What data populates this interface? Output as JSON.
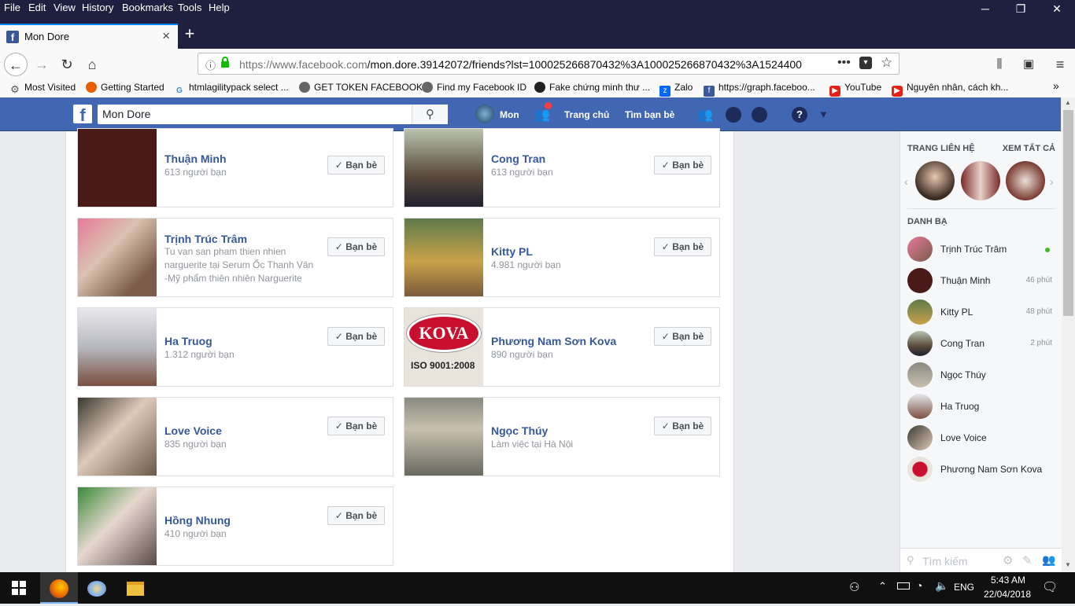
{
  "browser": {
    "menu": [
      "File",
      "Edit",
      "View",
      "History",
      "Bookmarks",
      "Tools",
      "Help"
    ],
    "tab_title": "Mon Dore",
    "url_host": "https://www.facebook.com",
    "url_path": "/mon.dore.39142072/friends?lst=100025266870432%3A100025266870432%3A1524400",
    "bookmarks": [
      "Most Visited",
      "Getting Started",
      "htmlagilitypack select ...",
      "GET TOKEN FACEBOOK",
      "Find my Facebook ID",
      "Fake chứng minh thư ...",
      "Zalo",
      "https://graph.faceboo...",
      "YouTube",
      "Nguyên nhân, cách kh..."
    ]
  },
  "fb": {
    "search_value": "Mon Dore",
    "profile_name": "Mon",
    "nav_home": "Trang chủ",
    "nav_find": "Tìm bạn bè"
  },
  "friends": [
    {
      "name": "Thuận Minh",
      "sub": "613 người bạn",
      "btn": "Bạn bè"
    },
    {
      "name": "Cong Tran",
      "sub": "613 người bạn",
      "btn": "Bạn bè"
    },
    {
      "name": "Trịnh Trúc Trâm",
      "sub": "Tu van san pham thien nhien narguerite tại Serum Ốc Thanh Vân -Mỹ phẩm thiên nhiên Narguerite",
      "btn": "Bạn bè"
    },
    {
      "name": "Kitty PL",
      "sub": "4.981 người bạn",
      "btn": "Bạn bè"
    },
    {
      "name": "Ha Truog",
      "sub": "1.312 người bạn",
      "btn": "Bạn bè"
    },
    {
      "name": "Phương Nam Sơn Kova",
      "sub": "890 người bạn",
      "btn": "Bạn bè"
    },
    {
      "name": "Love Voice",
      "sub": "835 người bạn",
      "btn": "Bạn bè"
    },
    {
      "name": "Ngọc Thúy",
      "sub": "Làm việc tại Hà Nội",
      "btn": "Bạn bè"
    },
    {
      "name": "Hồng Nhung",
      "sub": "410 người bạn",
      "btn": "Bạn bè"
    }
  ],
  "kova_text": "KOVA",
  "kova_iso": "ISO 9001:2008",
  "sidebar": {
    "pages_title": "TRANG LIÊN HỆ",
    "see_all": "XEM TẤT CẢ",
    "contacts_title": "DANH BẠ",
    "contacts": [
      {
        "name": "Trịnh Trúc Trâm",
        "time": ""
      },
      {
        "name": "Thuận Minh",
        "time": "46 phút"
      },
      {
        "name": "Kitty PL",
        "time": "48 phút"
      },
      {
        "name": "Cong Tran",
        "time": "2 phút"
      },
      {
        "name": "Ngọc Thúy",
        "time": ""
      },
      {
        "name": "Ha Truog",
        "time": ""
      },
      {
        "name": "Love Voice",
        "time": ""
      },
      {
        "name": "Phương Nam Sơn Kova",
        "time": ""
      }
    ],
    "search_placeholder": "Tìm kiếm"
  },
  "taskbar": {
    "time": "5:43 AM",
    "date": "22/04/2018",
    "lang": "ENG"
  }
}
